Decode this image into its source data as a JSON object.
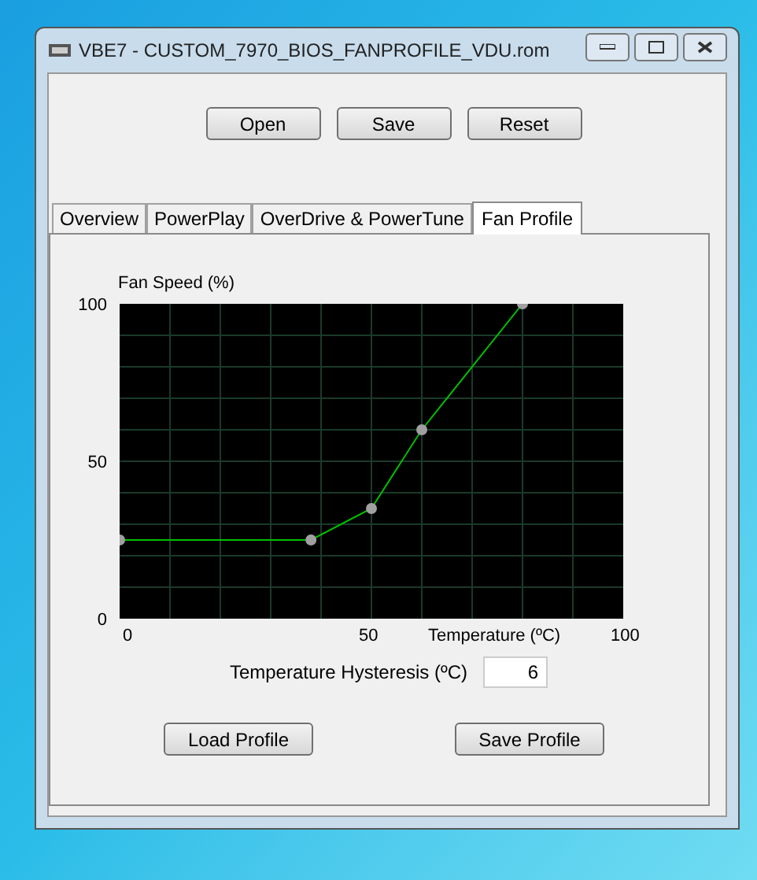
{
  "window": {
    "title": "VBE7 - CUSTOM_7970_BIOS_FANPROFILE_VDU.rom"
  },
  "toolbar": [
    "Open",
    "Save",
    "Reset"
  ],
  "tabs": [
    {
      "label": "Overview",
      "selected": false
    },
    {
      "label": "PowerPlay",
      "selected": false
    },
    {
      "label": "OverDrive & PowerTune",
      "selected": false
    },
    {
      "label": "Fan Profile",
      "selected": true
    }
  ],
  "fan_profile": {
    "chart_data": {
      "type": "line",
      "ylabel": "Fan Speed (%)",
      "xlabel": "Temperature (ºC)",
      "x": [
        0,
        38,
        50,
        60,
        80
      ],
      "series": [
        {
          "color": "#00c000",
          "marker": "circle",
          "values": [
            25,
            25,
            35,
            60,
            100
          ]
        }
      ],
      "xlim": [
        0,
        100
      ],
      "ylim": [
        0,
        100
      ],
      "xticks": [
        0,
        50,
        100
      ],
      "yticks": [
        0,
        50,
        100
      ]
    },
    "hysteresis": {
      "label": "Temperature Hysteresis (ºC)",
      "value": "6"
    },
    "buttons": [
      "Load Profile",
      "Save Profile"
    ]
  }
}
